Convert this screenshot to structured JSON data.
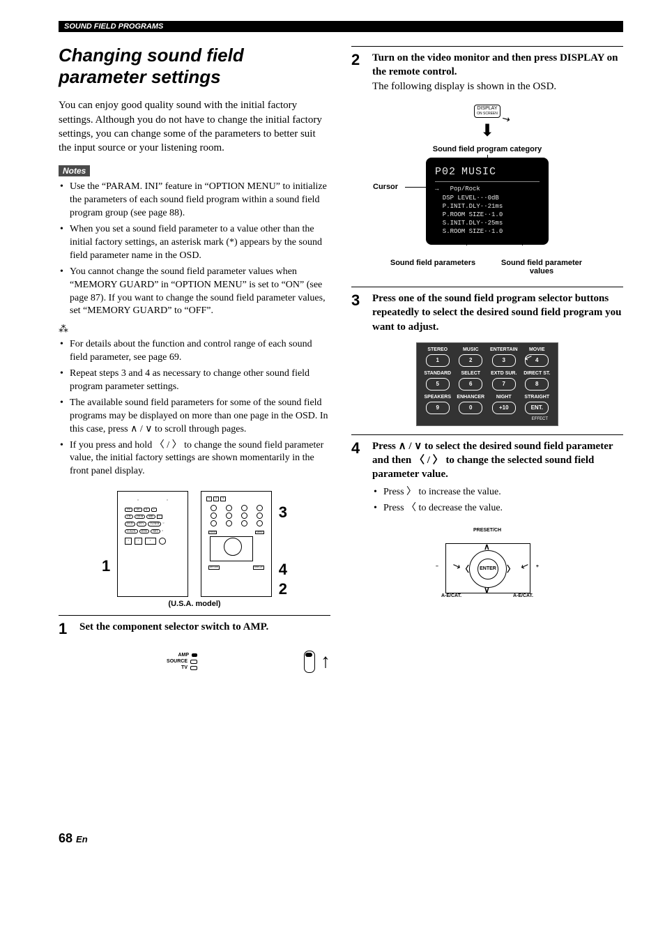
{
  "header": "SOUND FIELD PROGRAMS",
  "title": "Changing sound field parameter settings",
  "intro": "You can enjoy good quality sound with the initial factory settings. Although you do not have to change the initial factory settings, you can change some of the parameters to better suit the input source or your listening room.",
  "notes_label": "Notes",
  "notes": [
    "Use the “PARAM. INI” feature in “OPTION MENU” to initialize the parameters of each sound field program within a sound field program group (see page 88).",
    "When you set a sound field parameter to a value other than the initial factory settings, an asterisk mark (*) appears by the sound field parameter name in the OSD.",
    "You cannot change the sound field parameter values when “MEMORY GUARD” in “OPTION MENU” is set to “ON” (see page 87). If you want to change the sound field parameter values, set “MEMORY GUARD” to “OFF”."
  ],
  "tips": [
    "For details about the function and control range of each sound field parameter, see page 69.",
    "Repeat steps 3 and 4 as necessary to change other sound field program parameter settings.",
    "The available sound field parameters for some of the sound field programs may be displayed on more than one page in the OSD. In this case, press ∧ / ∨ to scroll through pages.",
    "If you press and hold 〈 / 〉 to change the sound field parameter value, the initial factory settings are shown momentarily in the front panel display."
  ],
  "model_caption": "(U.S.A. model)",
  "callouts": {
    "c1": "1",
    "c2": "2",
    "c3": "3",
    "c4": "4"
  },
  "step1": {
    "num": "1",
    "text": "Set the component selector switch to AMP."
  },
  "amp_labels": {
    "amp": "AMP",
    "source": "SOURCE",
    "tv": "TV"
  },
  "step2": {
    "num": "2",
    "bold": "Turn on the video monitor and then press DISPLAY on the remote control.",
    "body": "The following display is shown in the OSD."
  },
  "display_btn": {
    "l1": "DISPLAY",
    "l2": "ON SCREEN"
  },
  "osd": {
    "cat_label": "Sound field program category",
    "cursor_label": "Cursor",
    "param_label": "Sound field parameters",
    "value_label": "Sound field parameter values",
    "p02": "P02",
    "music": "MUSIC",
    "lines": "→   Pop/Rock\n  DSP LEVEL···0dB\n  P.INIT.DLY··21ms\n  P.ROOM SIZE··1.0\n  S.INIT.DLY··25ms\n  S.ROOM SIZE··1.0"
  },
  "step3": {
    "num": "3",
    "text": "Press one of the sound field program selector buttons repeatedly to select the desired sound field program you want to adjust."
  },
  "grid": {
    "r1": [
      "STEREO",
      "MUSIC",
      "ENTERTAIN",
      "MOVIE"
    ],
    "b1": [
      "1",
      "2",
      "3",
      "4"
    ],
    "r2": [
      "STANDARD",
      "SELECT",
      "EXTD SUR.",
      "DIRECT ST."
    ],
    "b2": [
      "5",
      "6",
      "7",
      "8"
    ],
    "r3": [
      "SPEAKERS",
      "ENHANCER",
      "NIGHT",
      "STRAIGHT"
    ],
    "b3": [
      "9",
      "0",
      "+10",
      "ENT."
    ],
    "effect": "EFFECT"
  },
  "step4": {
    "num": "4",
    "bold": "Press ∧ / ∨ to select the desired sound field parameter and then 〈 / 〉 to change the selected sound field parameter value.",
    "sub1": "Press 〉 to increase the value.",
    "sub2": "Press 〈 to decrease the value."
  },
  "nav": {
    "preset": "PRESET/CH",
    "enter": "ENTER",
    "aecat": "A-E/CAT.",
    "minus": "–",
    "plus": "+"
  },
  "page_num": "68",
  "page_suffix": "En"
}
